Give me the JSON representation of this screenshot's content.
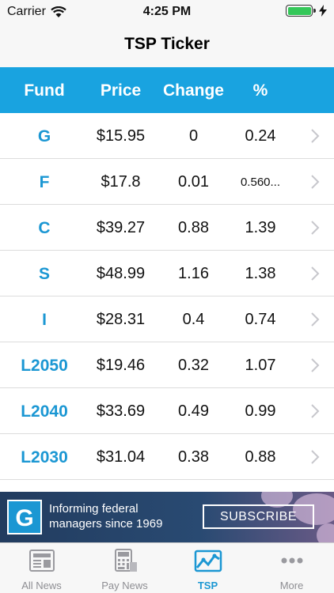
{
  "status_bar": {
    "carrier": "Carrier",
    "time": "4:25 PM"
  },
  "nav": {
    "title": "TSP Ticker"
  },
  "table": {
    "headers": [
      "Fund",
      "Price",
      "Change",
      "%"
    ],
    "rows": [
      {
        "fund": "G",
        "price": "$15.95",
        "change": "0",
        "pct": "0.24"
      },
      {
        "fund": "F",
        "price": "$17.8",
        "change": "0.01",
        "pct": "0.560..."
      },
      {
        "fund": "C",
        "price": "$39.27",
        "change": "0.88",
        "pct": "1.39"
      },
      {
        "fund": "S",
        "price": "$48.99",
        "change": "1.16",
        "pct": "1.38"
      },
      {
        "fund": "I",
        "price": "$28.31",
        "change": "0.4",
        "pct": "0.74"
      },
      {
        "fund": "L2050",
        "price": "$19.46",
        "change": "0.32",
        "pct": "1.07"
      },
      {
        "fund": "L2040",
        "price": "$33.69",
        "change": "0.49",
        "pct": "0.99"
      },
      {
        "fund": "L2030",
        "price": "$31.04",
        "change": "0.38",
        "pct": "0.88"
      }
    ]
  },
  "ad": {
    "logo_letter": "G",
    "text_line1": "Informing federal",
    "text_line2": "managers since 1969",
    "button": "SUBSCRIBE"
  },
  "tabs": [
    {
      "label": "All News",
      "icon": "newspaper-icon"
    },
    {
      "label": "Pay News",
      "icon": "calculator-icon"
    },
    {
      "label": "TSP",
      "icon": "chart-icon"
    },
    {
      "label": "More",
      "icon": "more-icon"
    }
  ],
  "colors": {
    "accent": "#19a3e0",
    "fund_text": "#1b97d3",
    "battery": "#34c759"
  }
}
